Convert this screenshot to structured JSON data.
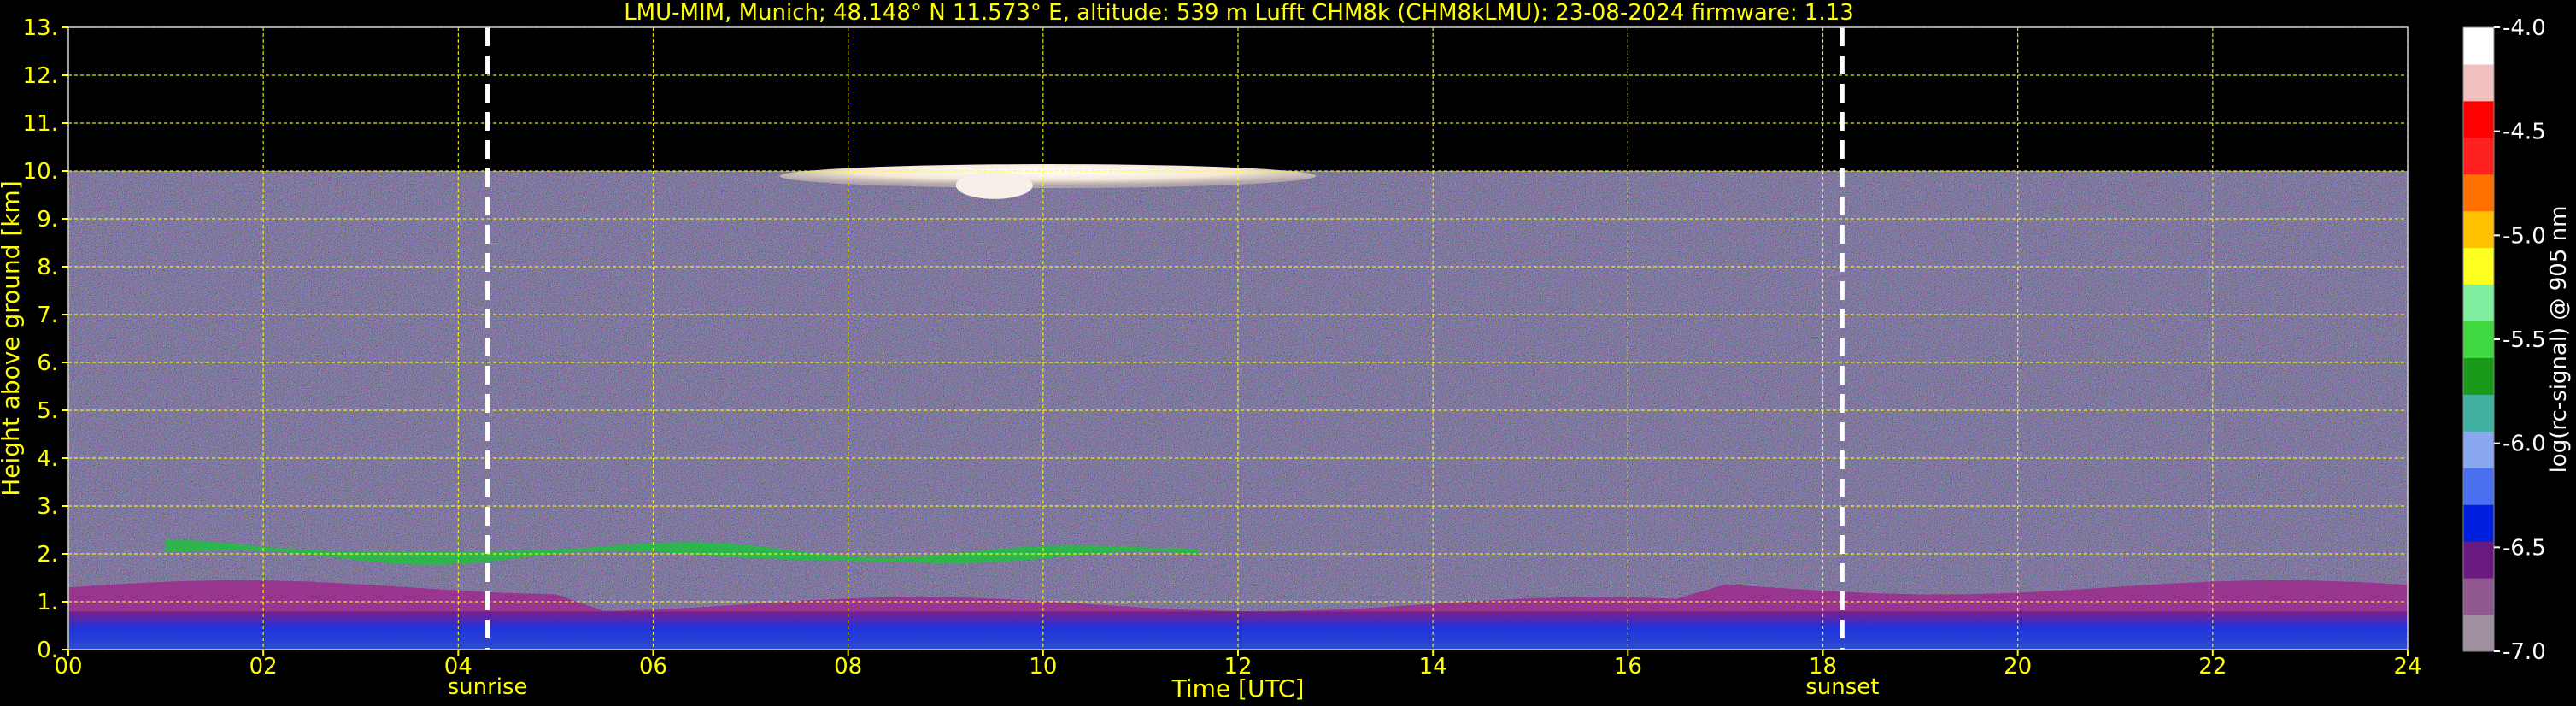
{
  "colors": {
    "background": "#000000",
    "text": "#ffff00",
    "grid": "#ffff00",
    "marker_line": "#ffffff"
  },
  "chart_data": {
    "type": "heatmap",
    "title": "LMU-MIM, Munich; 48.148° N 11.573° E, altitude: 539 m    Lufft CHM8k (CHM8kLMU): 23-08-2024    firmware: 1.13",
    "xlabel": "Time [UTC]",
    "ylabel": "Height above ground [km]",
    "xlim": [
      0,
      24
    ],
    "ylim": [
      0,
      13
    ],
    "x_ticks": [
      "00",
      "02",
      "04",
      "06",
      "08",
      "10",
      "12",
      "14",
      "16",
      "18",
      "20",
      "22",
      "24"
    ],
    "y_ticks": [
      "0.",
      "1.",
      "2.",
      "3.",
      "4.",
      "5.",
      "6.",
      "7.",
      "8.",
      "9.",
      "10.",
      "11.",
      "12.",
      "13."
    ],
    "grid": true,
    "data_top_km": 10,
    "markers": [
      {
        "x": 4.3,
        "label": "sunrise"
      },
      {
        "x": 18.2,
        "label": "sunset"
      }
    ],
    "features": {
      "cloud_layer": {
        "x_start": 7.3,
        "x_end": 12.8,
        "height_km": [
          9.6,
          10.0
        ]
      },
      "residual_layer_green": {
        "x_start": 1.0,
        "x_end": 11.6,
        "height_km": [
          1.8,
          2.3
        ]
      },
      "boundary_layer_blue": {
        "x_start": 0,
        "x_end": 24,
        "height_km": [
          0,
          0.8
        ]
      },
      "boundary_layer_magenta": {
        "x_start": 0,
        "x_end": 24,
        "height_km": [
          0.8,
          1.3
        ]
      }
    },
    "colorbar": {
      "label": "log(rc-signal) @ 905 nm",
      "range": [
        -7.0,
        -4.0
      ],
      "ticks": [
        "-4.0",
        "-4.5",
        "-5.0",
        "-5.5",
        "-6.0",
        "-6.5",
        "-7.0"
      ],
      "colors": [
        "#a090a0",
        "#905a90",
        "#6a1a80",
        "#0020e0",
        "#4a70f0",
        "#8aa8f0",
        "#40b0a0",
        "#1a9a1a",
        "#40d840",
        "#80f0a0",
        "#ffff20",
        "#ffc000",
        "#ff7000",
        "#ff2020",
        "#ff0000",
        "#f0c0c0",
        "#ffffff"
      ]
    }
  }
}
